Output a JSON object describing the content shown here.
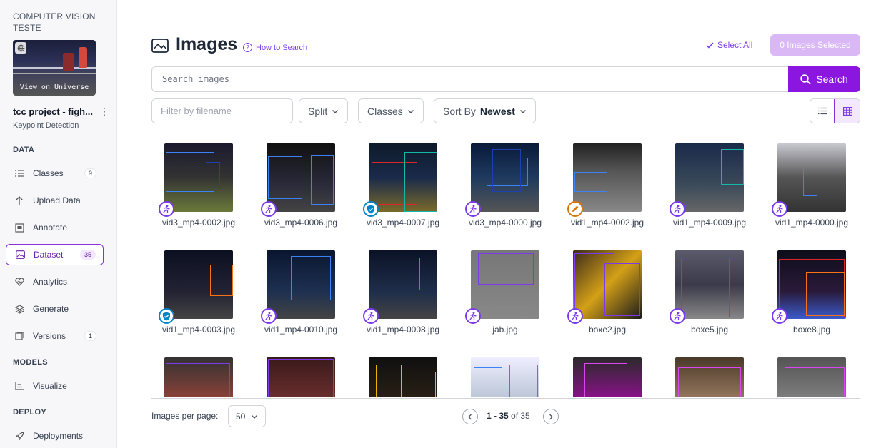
{
  "project": {
    "workspace": "COMPUTER VISION TESTE",
    "view_universe": "View on Universe",
    "name": "tcc project - figh...",
    "type": "Keypoint Detection"
  },
  "sidebar": {
    "sections": {
      "data": "DATA",
      "models": "MODELS",
      "deploy": "DEPLOY"
    },
    "items": [
      {
        "label": "Classes",
        "count": "9",
        "icon": "list-icon"
      },
      {
        "label": "Upload Data",
        "count": "",
        "icon": "upload-icon"
      },
      {
        "label": "Annotate",
        "count": "",
        "icon": "annotate-icon"
      },
      {
        "label": "Dataset",
        "count": "35",
        "icon": "images-icon"
      },
      {
        "label": "Analytics",
        "count": "",
        "icon": "analytics-icon"
      },
      {
        "label": "Generate",
        "count": "",
        "icon": "layers-icon"
      },
      {
        "label": "Versions",
        "count": "1",
        "icon": "versions-icon"
      },
      {
        "label": "Visualize",
        "count": "",
        "icon": "chart-icon"
      },
      {
        "label": "Deployments",
        "count": "",
        "icon": "rocket-icon"
      }
    ]
  },
  "header": {
    "title": "Images",
    "how_to_search": "How to Search",
    "select_all": "Select All",
    "selected": "0 Images Selected"
  },
  "search": {
    "placeholder": "Search images",
    "button": "Search"
  },
  "filters": {
    "filename_placeholder": "Filter by filename",
    "split": "Split",
    "classes": "Classes",
    "sort_by": "Sort By",
    "sort_value": "Newest"
  },
  "images": [
    {
      "name": "vid3_mp4-0002.jpg",
      "status": "person"
    },
    {
      "name": "vid3_mp4-0006.jpg",
      "status": "person"
    },
    {
      "name": "vid3_mp4-0007.jpg",
      "status": "approved"
    },
    {
      "name": "vid3_mp4-0000.jpg",
      "status": "person"
    },
    {
      "name": "vid1_mp4-0002.jpg",
      "status": "edited"
    },
    {
      "name": "vid1_mp4-0009.jpg",
      "status": "person"
    },
    {
      "name": "vid1_mp4-0000.jpg",
      "status": "person"
    },
    {
      "name": "vid1_mp4-0003.jpg",
      "status": "approved"
    },
    {
      "name": "vid1_mp4-0010.jpg",
      "status": "person"
    },
    {
      "name": "vid1_mp4-0008.jpg",
      "status": "person"
    },
    {
      "name": "jab.jpg",
      "status": "person"
    },
    {
      "name": "boxe2.jpg",
      "status": "person"
    },
    {
      "name": "boxe5.jpg",
      "status": "person"
    },
    {
      "name": "boxe8.jpg",
      "status": "person"
    },
    {
      "name": "",
      "status": ""
    },
    {
      "name": "",
      "status": ""
    },
    {
      "name": "",
      "status": ""
    },
    {
      "name": "",
      "status": ""
    },
    {
      "name": "",
      "status": ""
    },
    {
      "name": "",
      "status": ""
    },
    {
      "name": "",
      "status": ""
    }
  ],
  "pagination": {
    "per_page_label": "Images per page:",
    "per_page": "50",
    "range": "1 - 35",
    "of": "of 35"
  },
  "colors": {
    "accent": "#8b16e0",
    "badge_person": "#7c3aed",
    "badge_approved": "#0284c7",
    "badge_edited": "#d97706"
  }
}
